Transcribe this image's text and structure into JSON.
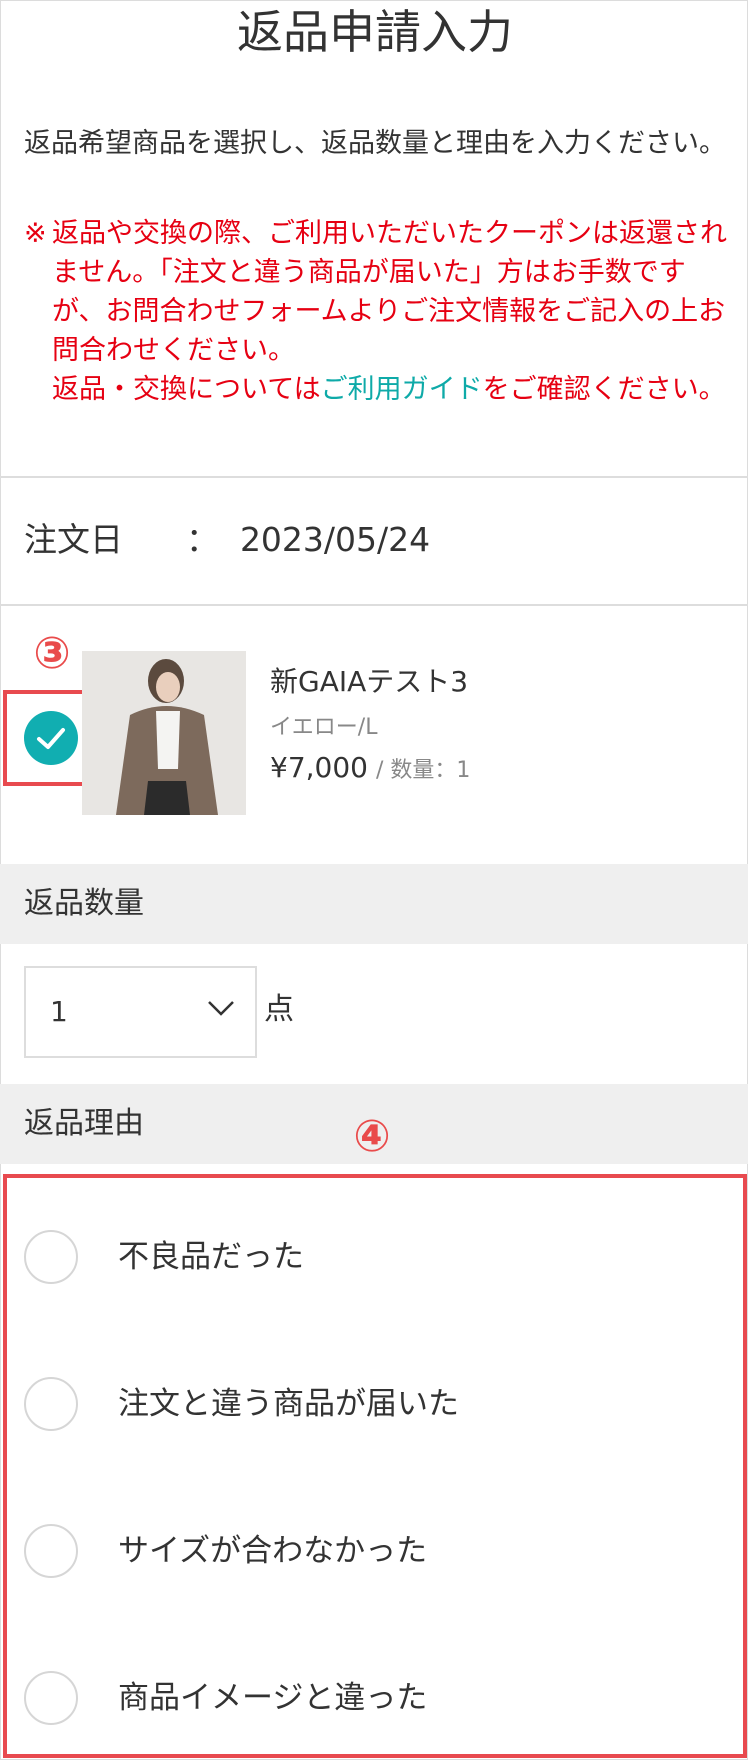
{
  "page_title": "返品申請入力",
  "intro": "返品希望商品を選択し、返品数量と理由を入力ください。",
  "notice": {
    "mark": "※",
    "line_a": "返品や交換の際、ご利用いただいたクーポンは返還されません。「注文と違う商品が届いた」方はお手数ですが、お問合わせフォームよりご注文情報をご記入の上お問合わせください。",
    "line_b_prefix": "返品・交換については",
    "line_b_link": "ご利用ガイド",
    "line_b_suffix": "をご確認ください。"
  },
  "order": {
    "label": "注文日",
    "separator": "：",
    "date": "2023/05/24"
  },
  "annotations": {
    "step3": "③",
    "step4": "④"
  },
  "product": {
    "name": "新GAIAテスト3",
    "variant": "イエロー/L",
    "price": "¥7,000",
    "qty_text": "/ 数量：1",
    "selected": true
  },
  "return_quantity": {
    "heading": "返品数量",
    "value": "1",
    "unit": "点"
  },
  "return_reason": {
    "heading": "返品理由",
    "options": [
      "不良品だった",
      "注文と違う商品が届いた",
      "サイズが合わなかった",
      "商品イメージと違った"
    ]
  },
  "colors": {
    "accent_teal": "#11aeb1",
    "notice_red": "#e60012",
    "annotation_red": "#e84a4f",
    "section_gray": "#efefef"
  }
}
